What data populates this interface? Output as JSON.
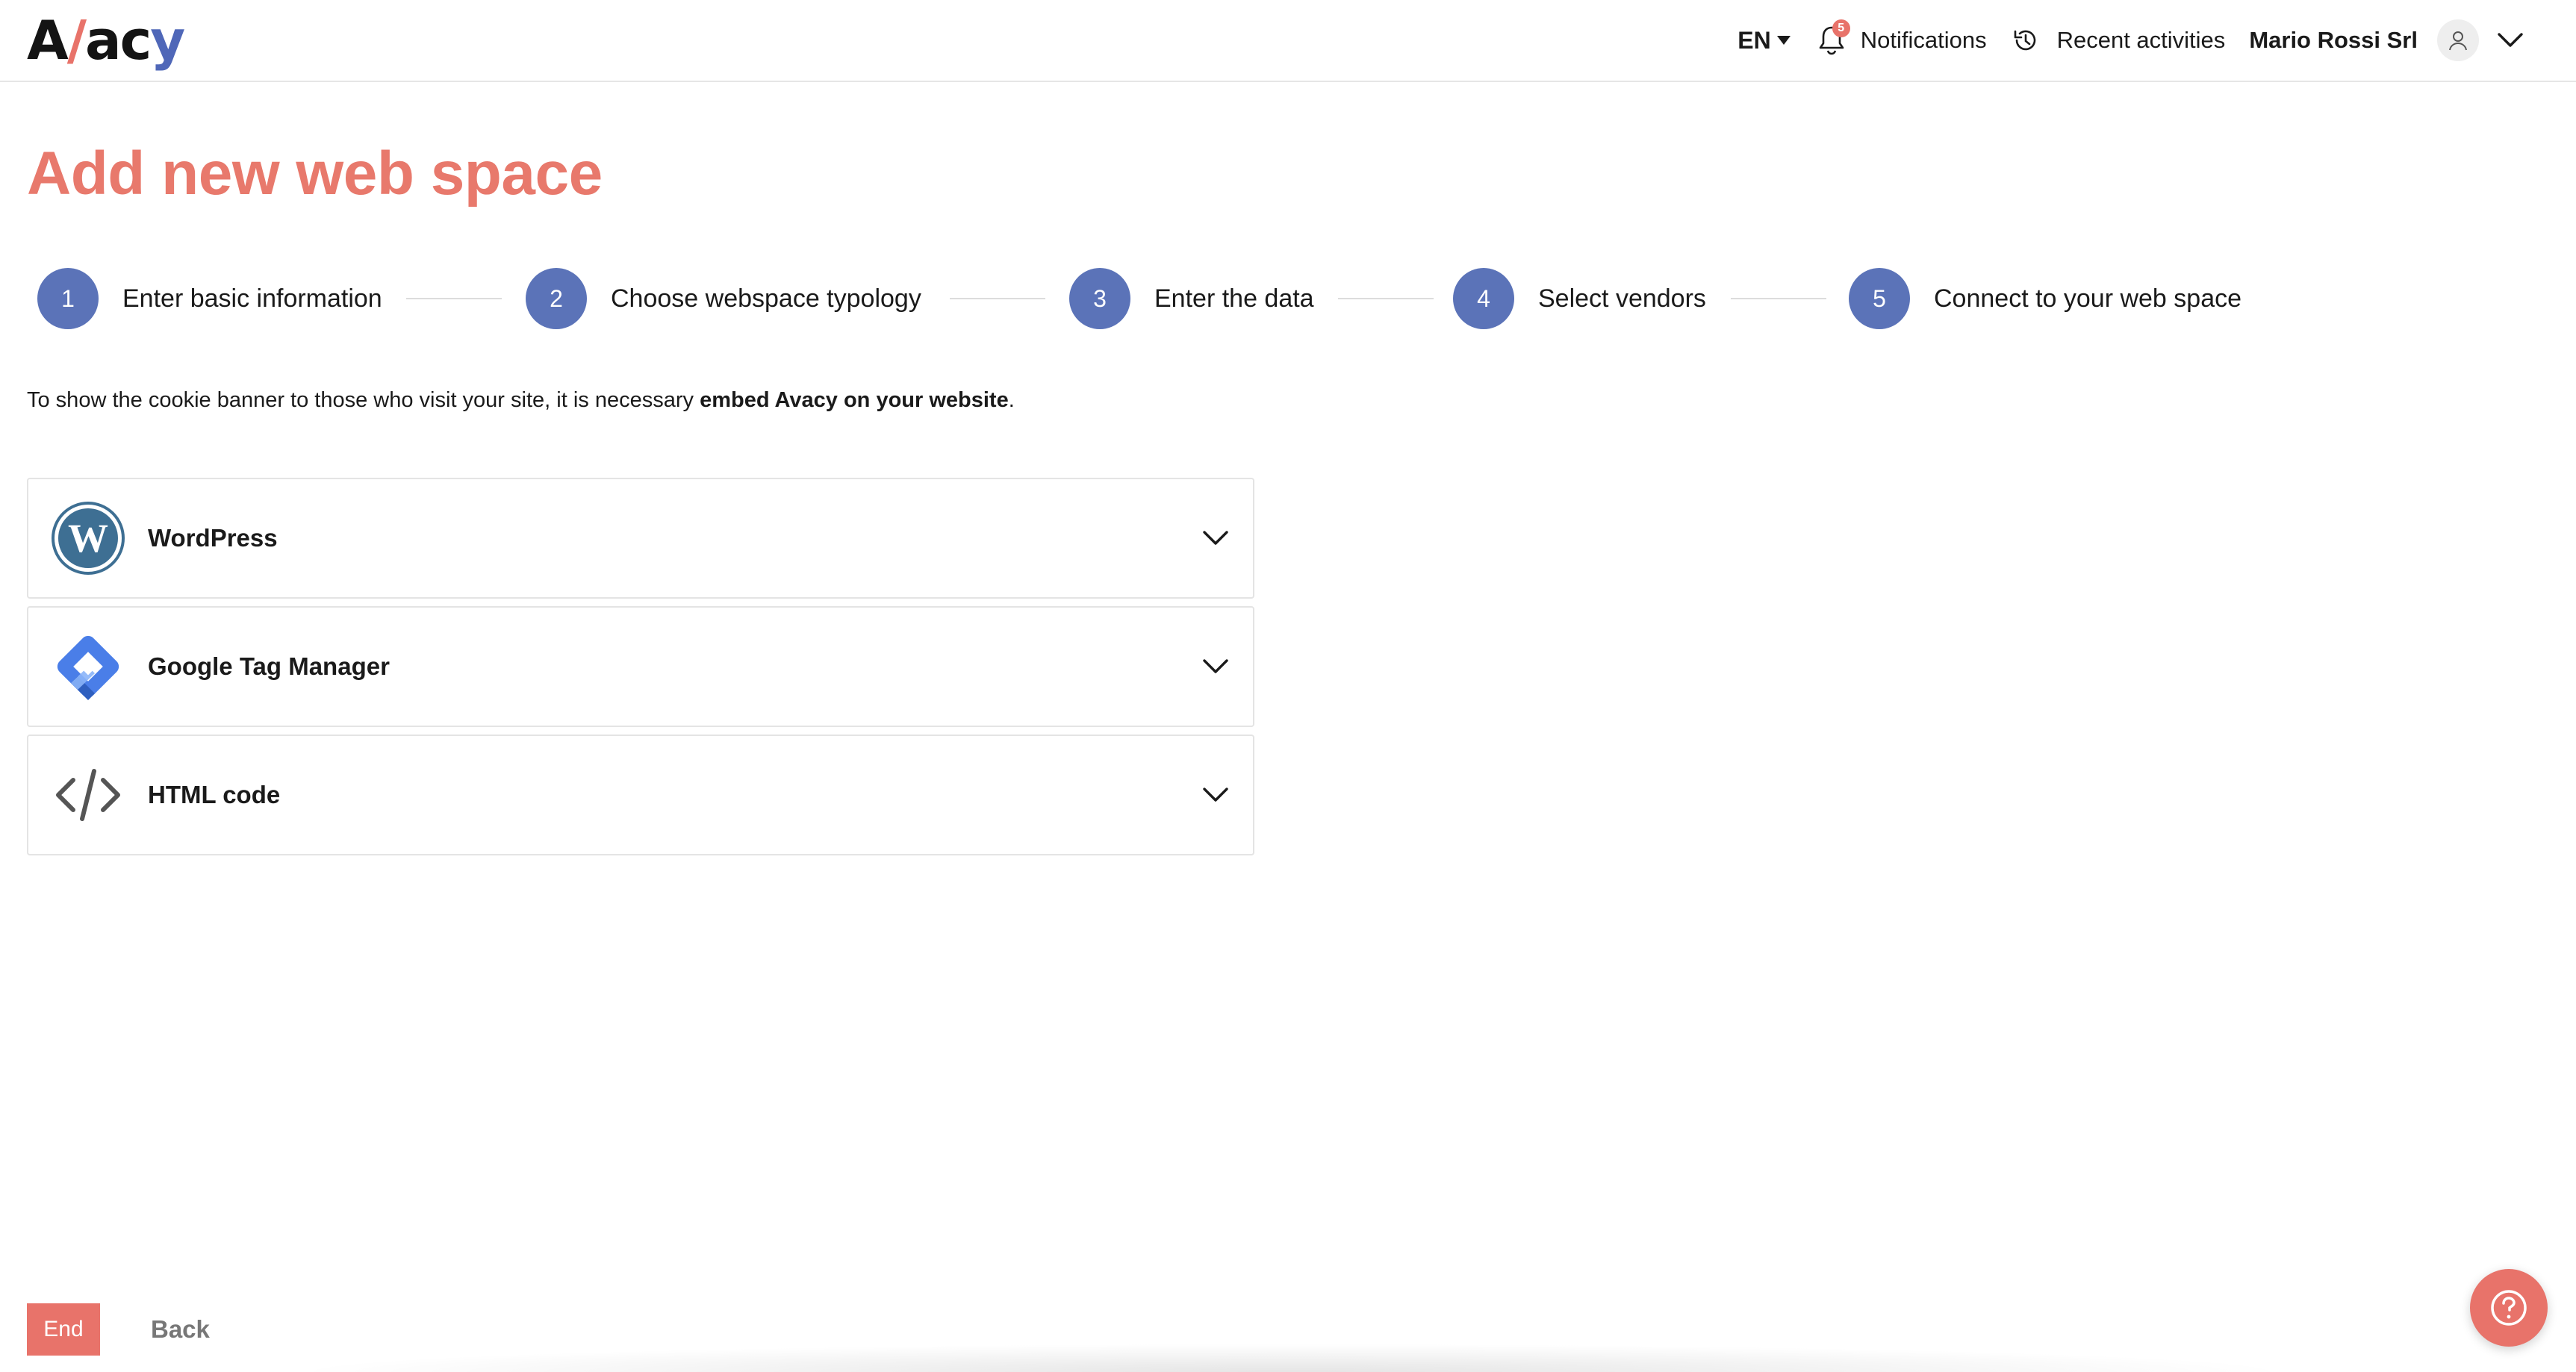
{
  "header": {
    "logo": {
      "part1": "A",
      "part2": "/",
      "part3": "ac",
      "part4": "y"
    },
    "language": "EN",
    "notifications_label": "Notifications",
    "notifications_count": "5",
    "recent_label": "Recent activities",
    "user_name": "Mario Rossi Srl"
  },
  "page": {
    "title": "Add new web space",
    "intro_prefix": "To show the cookie banner to those who visit your site, it is necessary ",
    "intro_bold": "embed Avacy on your website",
    "intro_suffix": "."
  },
  "stepper": {
    "steps": [
      {
        "number": "1",
        "label": "Enter basic information"
      },
      {
        "number": "2",
        "label": "Choose webspace typology"
      },
      {
        "number": "3",
        "label": "Enter the data"
      },
      {
        "number": "4",
        "label": "Select vendors"
      },
      {
        "number": "5",
        "label": "Connect to your web space"
      }
    ]
  },
  "integrations": [
    {
      "label": "WordPress",
      "icon": "wordpress-icon"
    },
    {
      "label": "Google Tag Manager",
      "icon": "google-tag-manager-icon"
    },
    {
      "label": "HTML code",
      "icon": "code-icon"
    }
  ],
  "footer": {
    "end_label": "End",
    "back_label": "Back"
  },
  "colors": {
    "accent": "#e8736a",
    "step": "#5b73b8"
  }
}
